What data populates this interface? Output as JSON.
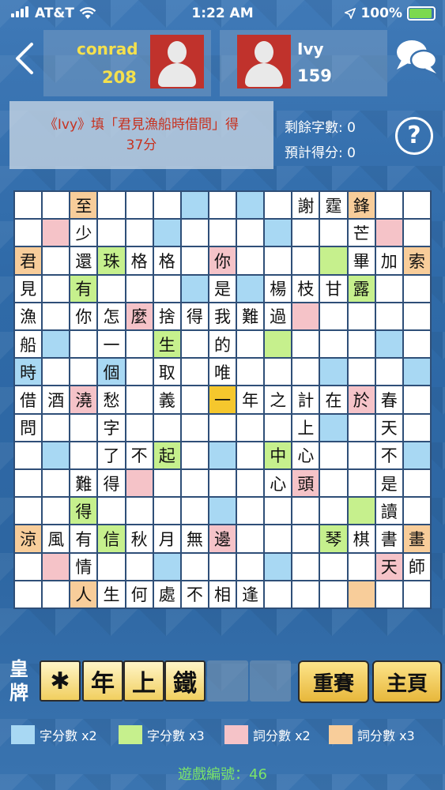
{
  "status_bar": {
    "carrier": "AT&T",
    "time": "1:22 AM",
    "battery": "100%"
  },
  "players": [
    {
      "name": "conrad",
      "score": "208"
    },
    {
      "name": "Ivy",
      "score": "159"
    }
  ],
  "last_move": {
    "line1": "《Ivy》填「君見漁船時借問」得",
    "line2": "37分"
  },
  "stats": {
    "remaining_label": "剩餘字數: 0",
    "estimated_label": "預計得分: 0"
  },
  "board": [
    [
      {
        "c": "",
        "t": "w"
      },
      {
        "c": "",
        "t": "w"
      },
      {
        "c": "至",
        "t": "or"
      },
      {
        "c": "",
        "t": "w"
      },
      {
        "c": "",
        "t": "w"
      },
      {
        "c": "",
        "t": "w"
      },
      {
        "c": "",
        "t": "bl"
      },
      {
        "c": "",
        "t": "w"
      },
      {
        "c": "",
        "t": "bl"
      },
      {
        "c": "",
        "t": "w"
      },
      {
        "c": "謝",
        "t": "w"
      },
      {
        "c": "霆",
        "t": "w"
      },
      {
        "c": "鋒",
        "t": "or"
      },
      {
        "c": "",
        "t": "w"
      },
      {
        "c": "",
        "t": "w"
      }
    ],
    [
      {
        "c": "",
        "t": "w"
      },
      {
        "c": "",
        "t": "pk"
      },
      {
        "c": "少",
        "t": "w"
      },
      {
        "c": "",
        "t": "w"
      },
      {
        "c": "",
        "t": "w"
      },
      {
        "c": "",
        "t": "bl"
      },
      {
        "c": "",
        "t": "w"
      },
      {
        "c": "",
        "t": "w"
      },
      {
        "c": "",
        "t": "w"
      },
      {
        "c": "",
        "t": "bl"
      },
      {
        "c": "",
        "t": "w"
      },
      {
        "c": "",
        "t": "w"
      },
      {
        "c": "芒",
        "t": "w"
      },
      {
        "c": "",
        "t": "pk"
      },
      {
        "c": "",
        "t": "w"
      }
    ],
    [
      {
        "c": "君",
        "t": "or"
      },
      {
        "c": "",
        "t": "w"
      },
      {
        "c": "還",
        "t": "w"
      },
      {
        "c": "珠",
        "t": "gr"
      },
      {
        "c": "格",
        "t": "w"
      },
      {
        "c": "格",
        "t": "w"
      },
      {
        "c": "",
        "t": "w"
      },
      {
        "c": "你",
        "t": "pk"
      },
      {
        "c": "",
        "t": "w"
      },
      {
        "c": "",
        "t": "w"
      },
      {
        "c": "",
        "t": "w"
      },
      {
        "c": "",
        "t": "gr"
      },
      {
        "c": "畢",
        "t": "w"
      },
      {
        "c": "加",
        "t": "w"
      },
      {
        "c": "索",
        "t": "or"
      }
    ],
    [
      {
        "c": "見",
        "t": "w"
      },
      {
        "c": "",
        "t": "w"
      },
      {
        "c": "有",
        "t": "gr"
      },
      {
        "c": "",
        "t": "w"
      },
      {
        "c": "",
        "t": "w"
      },
      {
        "c": "",
        "t": "w"
      },
      {
        "c": "",
        "t": "bl"
      },
      {
        "c": "是",
        "t": "w"
      },
      {
        "c": "",
        "t": "bl"
      },
      {
        "c": "楊",
        "t": "w"
      },
      {
        "c": "枝",
        "t": "w"
      },
      {
        "c": "甘",
        "t": "w"
      },
      {
        "c": "露",
        "t": "gr"
      },
      {
        "c": "",
        "t": "w"
      },
      {
        "c": "",
        "t": "w"
      }
    ],
    [
      {
        "c": "漁",
        "t": "w"
      },
      {
        "c": "",
        "t": "w"
      },
      {
        "c": "你",
        "t": "w"
      },
      {
        "c": "怎",
        "t": "w"
      },
      {
        "c": "麼",
        "t": "pk"
      },
      {
        "c": "捨",
        "t": "w"
      },
      {
        "c": "得",
        "t": "w"
      },
      {
        "c": "我",
        "t": "w"
      },
      {
        "c": "難",
        "t": "w"
      },
      {
        "c": "過",
        "t": "w"
      },
      {
        "c": "",
        "t": "pk"
      },
      {
        "c": "",
        "t": "w"
      },
      {
        "c": "",
        "t": "w"
      },
      {
        "c": "",
        "t": "w"
      },
      {
        "c": "",
        "t": "w"
      }
    ],
    [
      {
        "c": "船",
        "t": "w"
      },
      {
        "c": "",
        "t": "bl"
      },
      {
        "c": "",
        "t": "w"
      },
      {
        "c": "一",
        "t": "w"
      },
      {
        "c": "",
        "t": "w"
      },
      {
        "c": "生",
        "t": "gr"
      },
      {
        "c": "",
        "t": "w"
      },
      {
        "c": "的",
        "t": "w"
      },
      {
        "c": "",
        "t": "w"
      },
      {
        "c": "",
        "t": "gr"
      },
      {
        "c": "",
        "t": "w"
      },
      {
        "c": "",
        "t": "w"
      },
      {
        "c": "",
        "t": "w"
      },
      {
        "c": "",
        "t": "bl"
      },
      {
        "c": "",
        "t": "w"
      }
    ],
    [
      {
        "c": "時",
        "t": "bl"
      },
      {
        "c": "",
        "t": "w"
      },
      {
        "c": "",
        "t": "w"
      },
      {
        "c": "個",
        "t": "bl"
      },
      {
        "c": "",
        "t": "w"
      },
      {
        "c": "取",
        "t": "w"
      },
      {
        "c": "",
        "t": "w"
      },
      {
        "c": "唯",
        "t": "w"
      },
      {
        "c": "",
        "t": "w"
      },
      {
        "c": "",
        "t": "w"
      },
      {
        "c": "",
        "t": "w"
      },
      {
        "c": "",
        "t": "bl"
      },
      {
        "c": "",
        "t": "w"
      },
      {
        "c": "",
        "t": "w"
      },
      {
        "c": "",
        "t": "bl"
      }
    ],
    [
      {
        "c": "借",
        "t": "w"
      },
      {
        "c": "酒",
        "t": "w"
      },
      {
        "c": "澆",
        "t": "pk"
      },
      {
        "c": "愁",
        "t": "w"
      },
      {
        "c": "",
        "t": "w"
      },
      {
        "c": "義",
        "t": "w"
      },
      {
        "c": "",
        "t": "w"
      },
      {
        "c": "一",
        "t": "yl"
      },
      {
        "c": "年",
        "t": "w"
      },
      {
        "c": "之",
        "t": "w"
      },
      {
        "c": "計",
        "t": "w"
      },
      {
        "c": "在",
        "t": "w"
      },
      {
        "c": "於",
        "t": "pk"
      },
      {
        "c": "春",
        "t": "w"
      },
      {
        "c": "",
        "t": "w"
      }
    ],
    [
      {
        "c": "問",
        "t": "w"
      },
      {
        "c": "",
        "t": "w"
      },
      {
        "c": "",
        "t": "w"
      },
      {
        "c": "字",
        "t": "w"
      },
      {
        "c": "",
        "t": "w"
      },
      {
        "c": "",
        "t": "w"
      },
      {
        "c": "",
        "t": "w"
      },
      {
        "c": "",
        "t": "w"
      },
      {
        "c": "",
        "t": "w"
      },
      {
        "c": "",
        "t": "w"
      },
      {
        "c": "上",
        "t": "w"
      },
      {
        "c": "",
        "t": "bl"
      },
      {
        "c": "",
        "t": "w"
      },
      {
        "c": "天",
        "t": "w"
      },
      {
        "c": "",
        "t": "w"
      }
    ],
    [
      {
        "c": "",
        "t": "w"
      },
      {
        "c": "",
        "t": "bl"
      },
      {
        "c": "",
        "t": "w"
      },
      {
        "c": "了",
        "t": "w"
      },
      {
        "c": "不",
        "t": "w"
      },
      {
        "c": "起",
        "t": "gr"
      },
      {
        "c": "",
        "t": "w"
      },
      {
        "c": "",
        "t": "bl"
      },
      {
        "c": "",
        "t": "w"
      },
      {
        "c": "中",
        "t": "gr"
      },
      {
        "c": "心",
        "t": "w"
      },
      {
        "c": "",
        "t": "w"
      },
      {
        "c": "",
        "t": "w"
      },
      {
        "c": "不",
        "t": "w"
      },
      {
        "c": "",
        "t": "bl"
      }
    ],
    [
      {
        "c": "",
        "t": "w"
      },
      {
        "c": "",
        "t": "w"
      },
      {
        "c": "難",
        "t": "w"
      },
      {
        "c": "得",
        "t": "w"
      },
      {
        "c": "",
        "t": "pk"
      },
      {
        "c": "",
        "t": "w"
      },
      {
        "c": "",
        "t": "w"
      },
      {
        "c": "",
        "t": "w"
      },
      {
        "c": "",
        "t": "w"
      },
      {
        "c": "心",
        "t": "w"
      },
      {
        "c": "頭",
        "t": "pk"
      },
      {
        "c": "",
        "t": "w"
      },
      {
        "c": "",
        "t": "w"
      },
      {
        "c": "是",
        "t": "w"
      },
      {
        "c": "",
        "t": "w"
      }
    ],
    [
      {
        "c": "",
        "t": "w"
      },
      {
        "c": "",
        "t": "w"
      },
      {
        "c": "得",
        "t": "gr"
      },
      {
        "c": "",
        "t": "w"
      },
      {
        "c": "",
        "t": "w"
      },
      {
        "c": "",
        "t": "w"
      },
      {
        "c": "",
        "t": "w"
      },
      {
        "c": "",
        "t": "bl"
      },
      {
        "c": "",
        "t": "w"
      },
      {
        "c": "",
        "t": "w"
      },
      {
        "c": "",
        "t": "w"
      },
      {
        "c": "",
        "t": "w"
      },
      {
        "c": "",
        "t": "gr"
      },
      {
        "c": "讀",
        "t": "w"
      },
      {
        "c": "",
        "t": "w"
      }
    ],
    [
      {
        "c": "涼",
        "t": "or"
      },
      {
        "c": "風",
        "t": "w"
      },
      {
        "c": "有",
        "t": "w"
      },
      {
        "c": "信",
        "t": "gr"
      },
      {
        "c": "秋",
        "t": "w"
      },
      {
        "c": "月",
        "t": "w"
      },
      {
        "c": "無",
        "t": "w"
      },
      {
        "c": "邊",
        "t": "pk"
      },
      {
        "c": "",
        "t": "w"
      },
      {
        "c": "",
        "t": "w"
      },
      {
        "c": "",
        "t": "w"
      },
      {
        "c": "琴",
        "t": "gr"
      },
      {
        "c": "棋",
        "t": "w"
      },
      {
        "c": "書",
        "t": "w"
      },
      {
        "c": "畫",
        "t": "or"
      }
    ],
    [
      {
        "c": "",
        "t": "w"
      },
      {
        "c": "",
        "t": "pk"
      },
      {
        "c": "情",
        "t": "w"
      },
      {
        "c": "",
        "t": "w"
      },
      {
        "c": "",
        "t": "w"
      },
      {
        "c": "",
        "t": "bl"
      },
      {
        "c": "",
        "t": "w"
      },
      {
        "c": "",
        "t": "w"
      },
      {
        "c": "",
        "t": "w"
      },
      {
        "c": "",
        "t": "bl"
      },
      {
        "c": "",
        "t": "w"
      },
      {
        "c": "",
        "t": "w"
      },
      {
        "c": "",
        "t": "w"
      },
      {
        "c": "天",
        "t": "pk"
      },
      {
        "c": "師",
        "t": "w"
      }
    ],
    [
      {
        "c": "",
        "t": "w"
      },
      {
        "c": "",
        "t": "w"
      },
      {
        "c": "人",
        "t": "or"
      },
      {
        "c": "生",
        "t": "w"
      },
      {
        "c": "何",
        "t": "w"
      },
      {
        "c": "處",
        "t": "w"
      },
      {
        "c": "不",
        "t": "w"
      },
      {
        "c": "相",
        "t": "w"
      },
      {
        "c": "逢",
        "t": "w"
      },
      {
        "c": "",
        "t": "w"
      },
      {
        "c": "",
        "t": "w"
      },
      {
        "c": "",
        "t": "w"
      },
      {
        "c": "",
        "t": "or"
      },
      {
        "c": "",
        "t": "w"
      },
      {
        "c": "",
        "t": "w"
      }
    ]
  ],
  "rack": {
    "label_line1": "皇",
    "label_line2": "牌",
    "tiles": [
      "✱",
      "年",
      "上",
      "鐵",
      "",
      ""
    ]
  },
  "buttons": {
    "rematch": "重賽",
    "home": "主頁"
  },
  "legend": [
    {
      "label": "字分數 x2",
      "color": "#a8d8f3"
    },
    {
      "label": "字分數 x3",
      "color": "#c6f08d"
    },
    {
      "label": "詞分數 x2",
      "color": "#f5c3c8"
    },
    {
      "label": "詞分數 x3",
      "color": "#f8cd9a"
    }
  ],
  "game_number": "遊戲編號：46",
  "icons": [
    "signal-bars-icon",
    "wifi-icon",
    "location-arrow-icon",
    "battery-icon",
    "back-chevron-icon",
    "avatar-icon",
    "chat-bubbles-icon",
    "help-icon"
  ]
}
